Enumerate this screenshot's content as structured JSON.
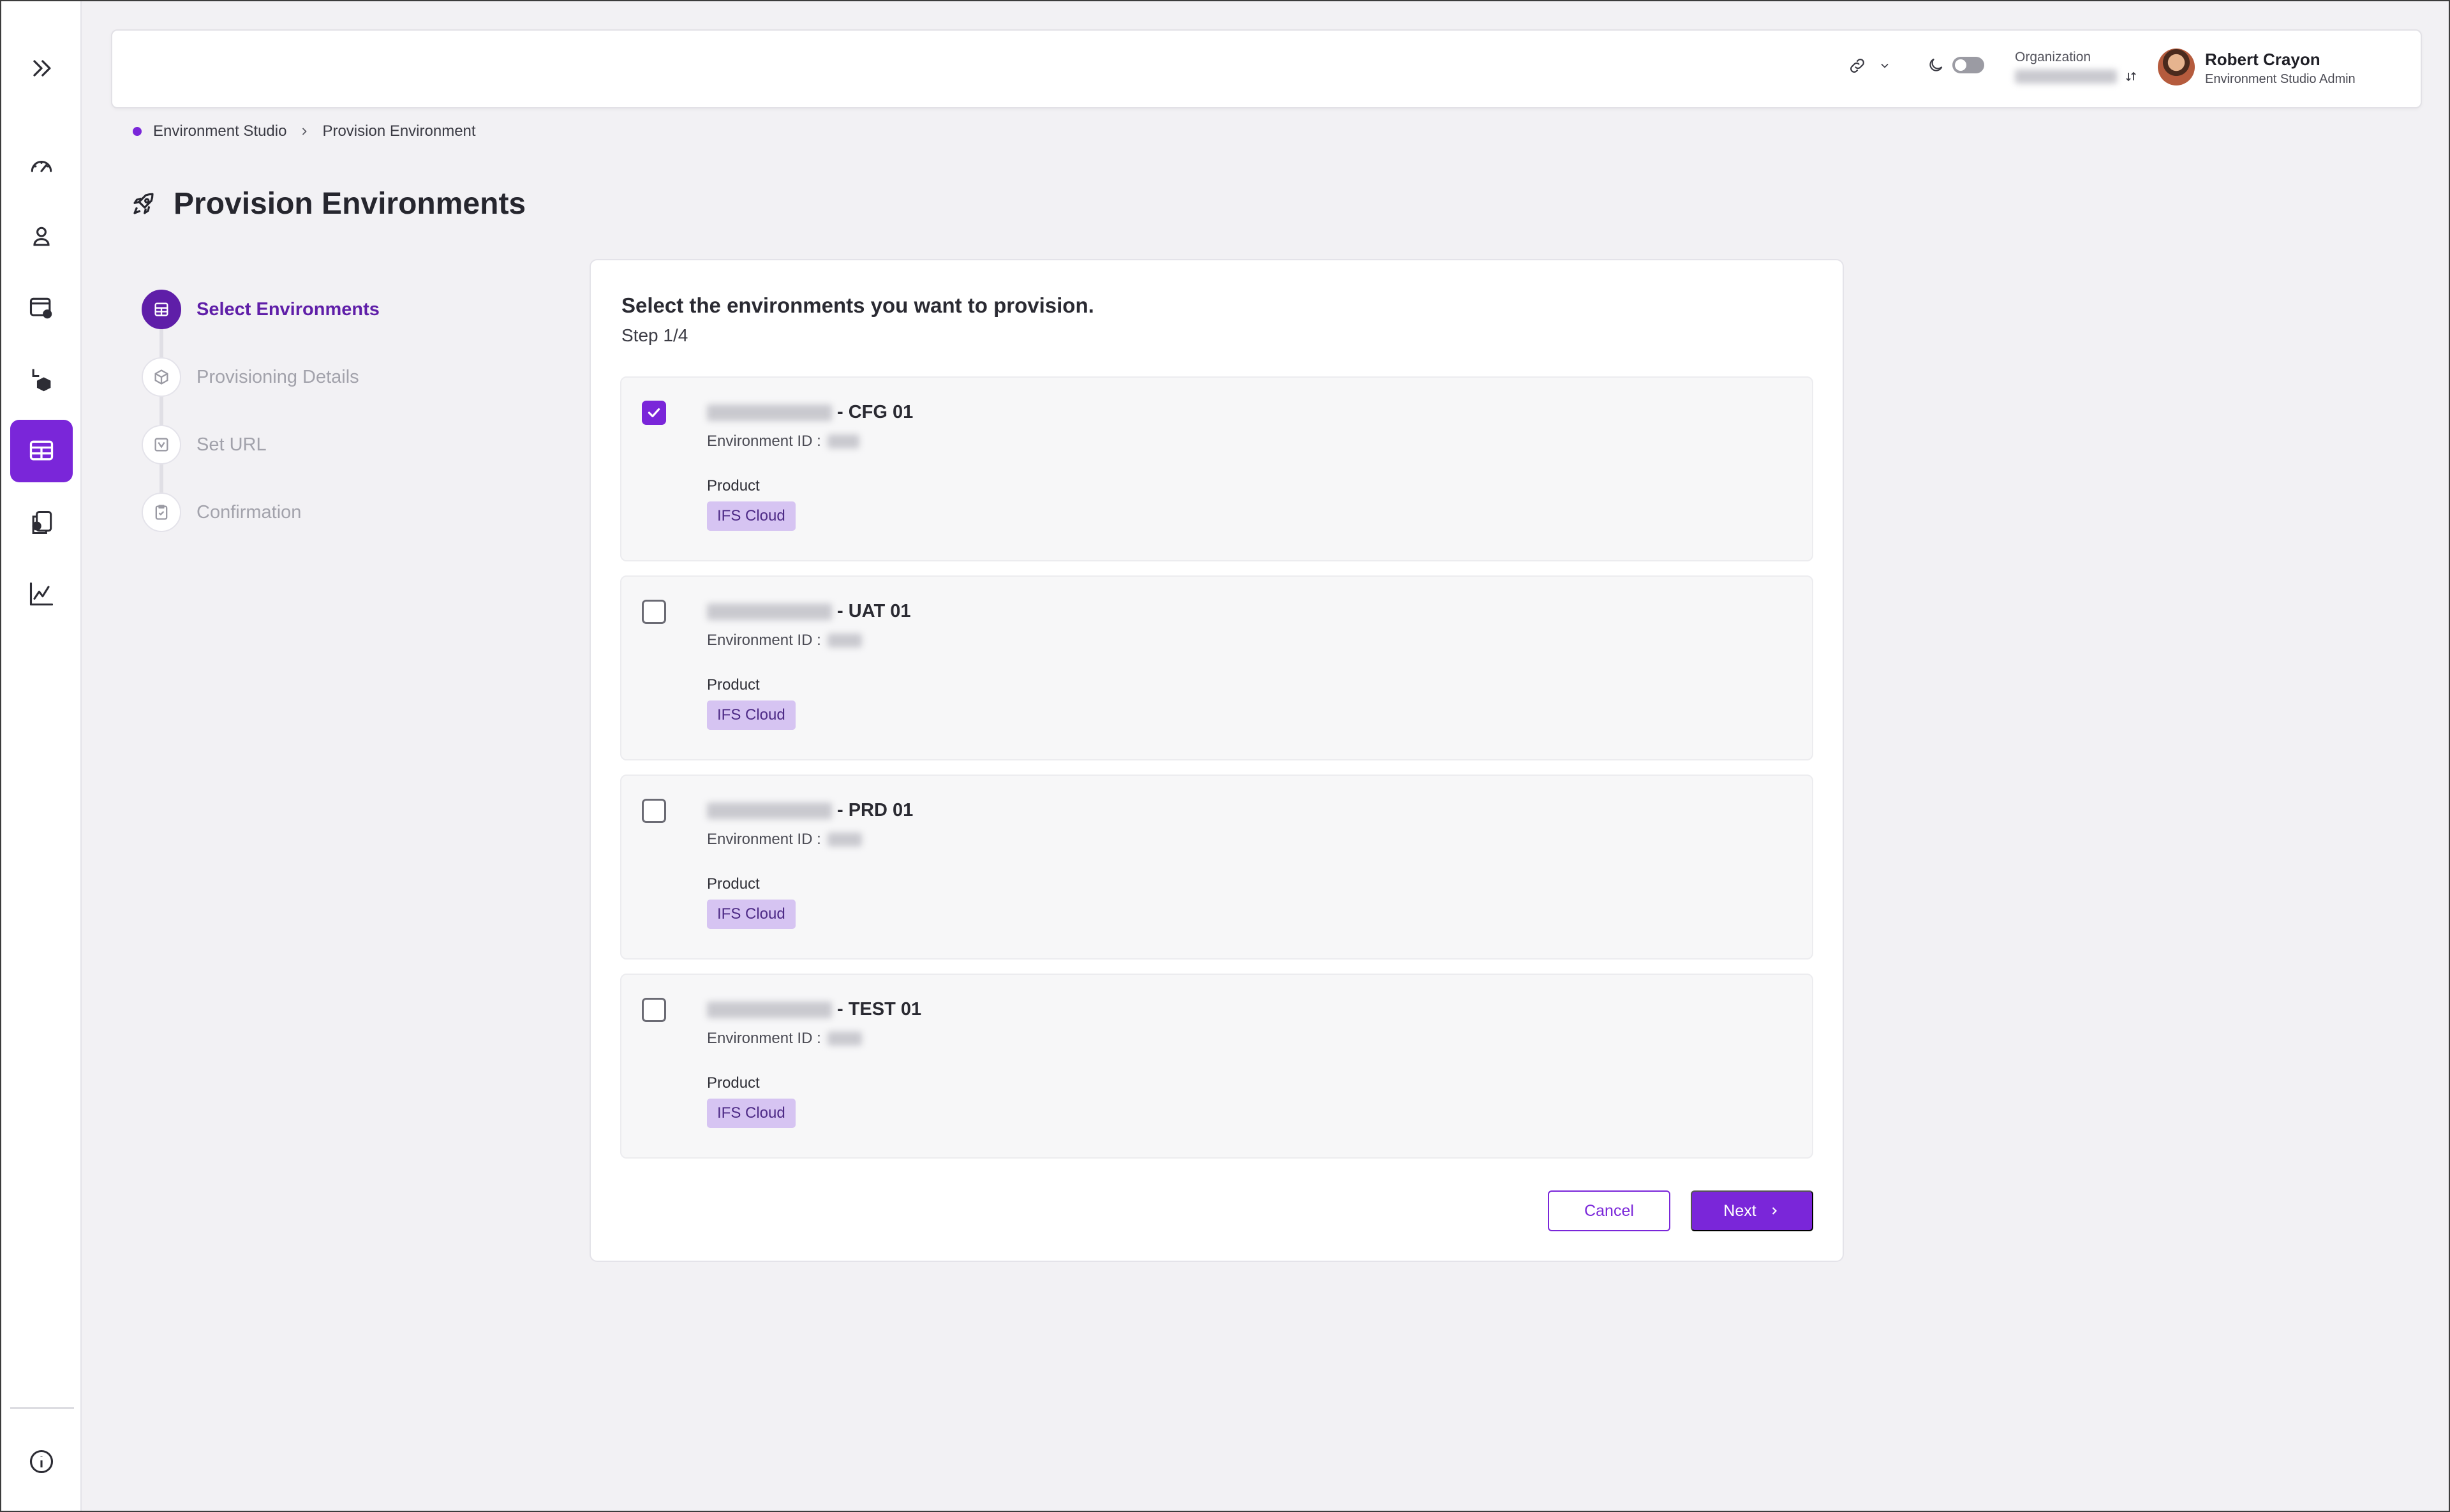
{
  "header": {
    "org_label": "Organization",
    "user_name": "Robert Crayon",
    "user_role": "Environment Studio Admin"
  },
  "breadcrumb": [
    "Environment Studio",
    "Provision Environment"
  ],
  "page_title": "Provision Environments",
  "steps": [
    {
      "label": "Select Environments",
      "active": true,
      "icon": "table-icon"
    },
    {
      "label": "Provisioning Details",
      "active": false,
      "icon": "cube-icon"
    },
    {
      "label": "Set URL",
      "active": false,
      "icon": "url-icon"
    },
    {
      "label": "Confirmation",
      "active": false,
      "icon": "clipboard-check-icon"
    }
  ],
  "card": {
    "title": "Select the environments you want to provision.",
    "step": "Step 1/4"
  },
  "environments": [
    {
      "name_suffix": "- CFG 01",
      "id_label": "Environment ID :",
      "product_label": "Product",
      "product": "IFS Cloud",
      "checked": true
    },
    {
      "name_suffix": "- UAT 01",
      "id_label": "Environment ID :",
      "product_label": "Product",
      "product": "IFS Cloud",
      "checked": false
    },
    {
      "name_suffix": "- PRD 01",
      "id_label": "Environment ID :",
      "product_label": "Product",
      "product": "IFS Cloud",
      "checked": false
    },
    {
      "name_suffix": "- TEST 01",
      "id_label": "Environment ID :",
      "product_label": "Product",
      "product": "IFS Cloud",
      "checked": false
    }
  ],
  "actions": {
    "cancel": "Cancel",
    "next": "Next"
  },
  "colors": {
    "accent": "#7a26d9",
    "accent_dark": "#5f1ea8",
    "badge_bg": "#d6c4f2"
  }
}
